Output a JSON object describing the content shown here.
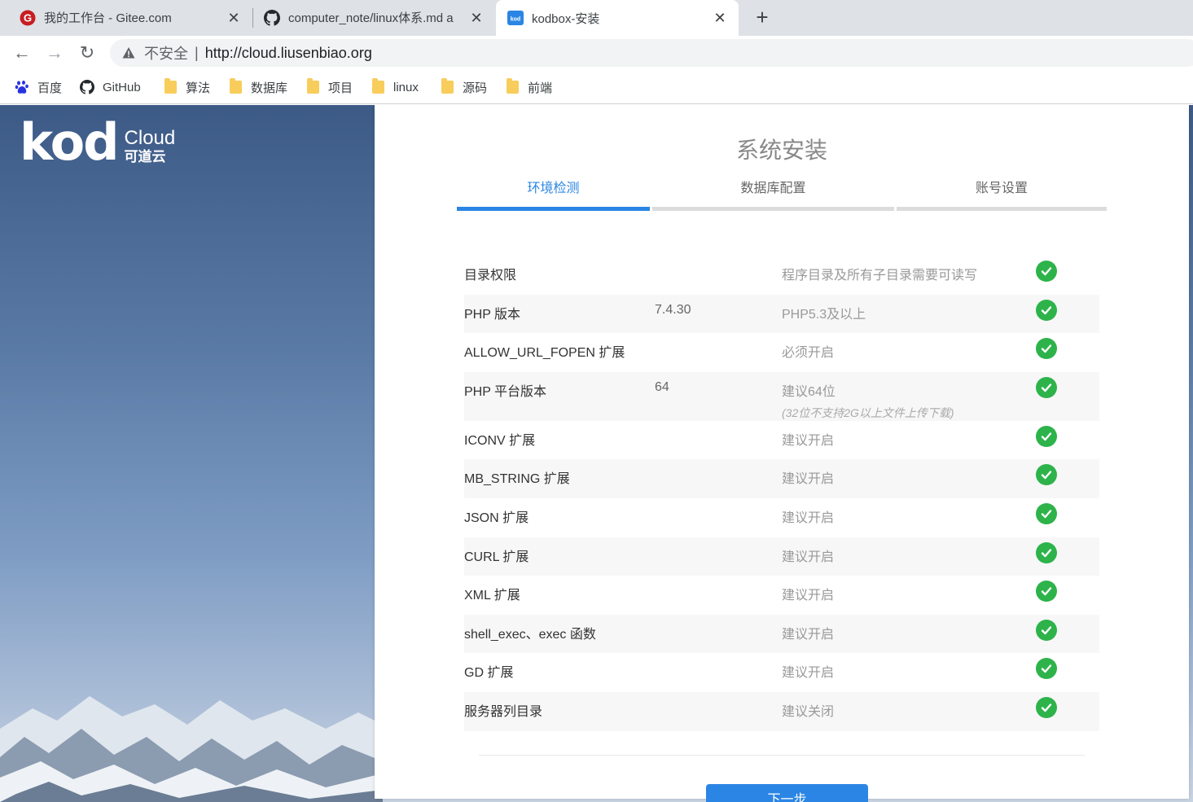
{
  "browser": {
    "tabs": [
      {
        "title": "我的工作台 - Gitee.com",
        "icon": "gitee-icon"
      },
      {
        "title": "computer_note/linux体系.md a",
        "icon": "github-icon"
      },
      {
        "title": "kodbox-安装",
        "icon": "kod-icon",
        "active": true
      }
    ],
    "new_tab_label": "+",
    "close_label": "✕",
    "nav": {
      "back": "←",
      "forward": "→",
      "reload": "↻"
    },
    "address": {
      "security_label": "不安全",
      "divider": "|",
      "url": "http://cloud.liusenbiao.org"
    },
    "bookmarks": [
      {
        "label": "百度",
        "icon": "baidu-icon"
      },
      {
        "label": "GitHub",
        "icon": "github-icon"
      },
      {
        "label": "算法",
        "icon": "folder-icon"
      },
      {
        "label": "数据库",
        "icon": "folder-icon"
      },
      {
        "label": "项目",
        "icon": "folder-icon"
      },
      {
        "label": "linux",
        "icon": "folder-icon"
      },
      {
        "label": "源码",
        "icon": "folder-icon"
      },
      {
        "label": "前端",
        "icon": "folder-icon"
      }
    ]
  },
  "logo": {
    "mark": "kod",
    "brand_en": "Cloud",
    "brand_cn": "可道云"
  },
  "install": {
    "title": "系统安装",
    "steps": [
      {
        "label": "环境检测",
        "active": true
      },
      {
        "label": "数据库配置",
        "active": false
      },
      {
        "label": "账号设置",
        "active": false
      }
    ],
    "requirements": [
      {
        "name": "目录权限",
        "value": "",
        "requirement": "程序目录及所有子目录需要可读写",
        "note": "",
        "status": "ok"
      },
      {
        "name": "PHP 版本",
        "value": "7.4.30",
        "requirement": "PHP5.3及以上",
        "note": "",
        "status": "ok"
      },
      {
        "name": "ALLOW_URL_FOPEN 扩展",
        "value": "",
        "requirement": "必须开启",
        "note": "",
        "status": "ok"
      },
      {
        "name": "PHP 平台版本",
        "value": "64",
        "requirement": "建议64位",
        "note": "(32位不支持2G以上文件上传下载)",
        "status": "ok"
      },
      {
        "name": "ICONV 扩展",
        "value": "",
        "requirement": "建议开启",
        "note": "",
        "status": "ok"
      },
      {
        "name": "MB_STRING 扩展",
        "value": "",
        "requirement": "建议开启",
        "note": "",
        "status": "ok"
      },
      {
        "name": "JSON 扩展",
        "value": "",
        "requirement": "建议开启",
        "note": "",
        "status": "ok"
      },
      {
        "name": "CURL 扩展",
        "value": "",
        "requirement": "建议开启",
        "note": "",
        "status": "ok"
      },
      {
        "name": "XML 扩展",
        "value": "",
        "requirement": "建议开启",
        "note": "",
        "status": "ok"
      },
      {
        "name": "shell_exec、exec 函数",
        "value": "",
        "requirement": "建议开启",
        "note": "",
        "status": "ok"
      },
      {
        "name": "GD 扩展",
        "value": "",
        "requirement": "建议开启",
        "note": "",
        "status": "ok"
      },
      {
        "name": "服务器列目录",
        "value": "",
        "requirement": "建议关闭",
        "note": "",
        "status": "ok"
      }
    ],
    "next_button": "下一步"
  },
  "colors": {
    "accent": "#2b85e4",
    "success": "#2db34a",
    "tabstrip": "#dee1e6"
  }
}
